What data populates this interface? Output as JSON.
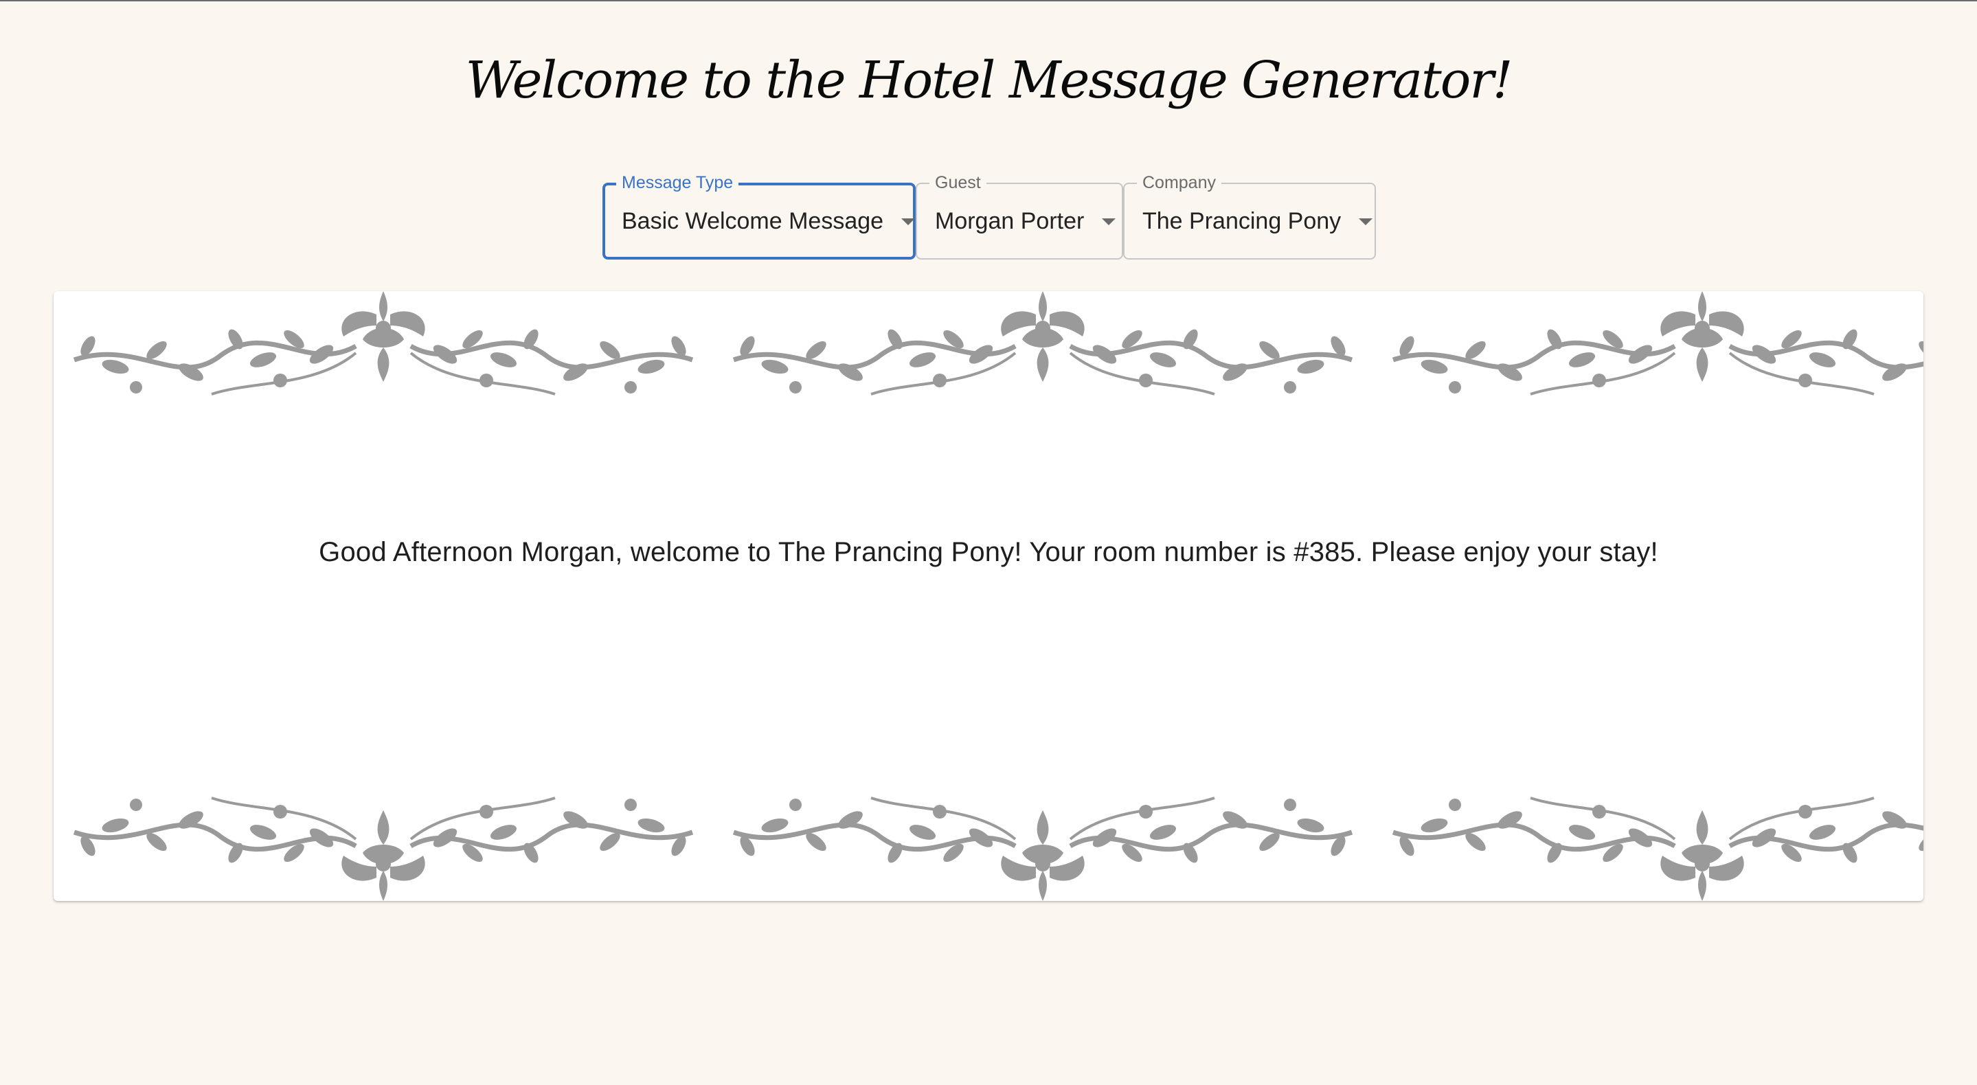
{
  "page": {
    "title": "Welcome to the Hotel Message Generator!"
  },
  "controls": {
    "message_type": {
      "label": "Message Type",
      "value": "Basic Welcome Message"
    },
    "guest": {
      "label": "Guest",
      "value": "Morgan Porter"
    },
    "company": {
      "label": "Company",
      "value": "The Prancing Pony"
    }
  },
  "card": {
    "message": "Good Afternoon Morgan, welcome to The Prancing Pony! Your room number is #385. Please enjoy your stay!",
    "ornament_icon": "damask-floral-border"
  },
  "colors": {
    "background": "#fbf6f0",
    "accent": "#3a73c4",
    "ornament": "#9a9a9a"
  }
}
